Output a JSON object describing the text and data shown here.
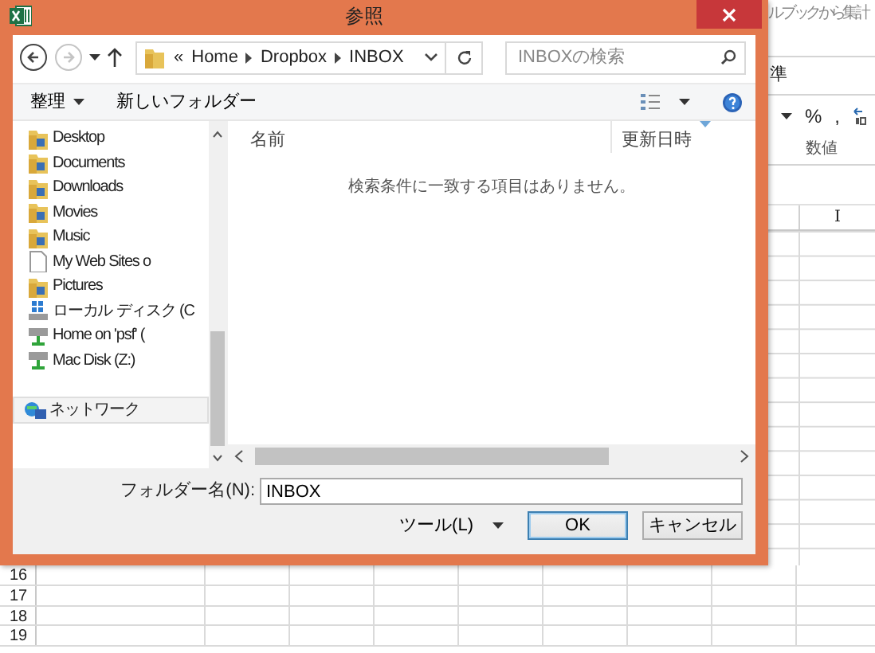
{
  "dialog": {
    "title": "参照",
    "navigation": {
      "back_disabled": false,
      "forward_disabled": true
    },
    "address": {
      "overflow": "«",
      "crumbs": [
        "Home",
        "Dropbox",
        "INBOX"
      ]
    },
    "search": {
      "placeholder": "INBOXの検索"
    },
    "toolbar": {
      "organize": "整理",
      "new_folder": "新しいフォルダー"
    },
    "nav_items": [
      {
        "label": "Desktop",
        "kind": "folder",
        "selected": false
      },
      {
        "label": "Documents",
        "kind": "folder",
        "selected": false
      },
      {
        "label": "Downloads",
        "kind": "folder",
        "selected": false
      },
      {
        "label": "Movies",
        "kind": "folder",
        "selected": false
      },
      {
        "label": "Music",
        "kind": "folder",
        "selected": false
      },
      {
        "label": "My Web Sites o",
        "kind": "file",
        "selected": false
      },
      {
        "label": "Pictures",
        "kind": "folder",
        "selected": false
      },
      {
        "label": "ローカル ディスク (C",
        "kind": "drive",
        "selected": false
      },
      {
        "label": "Home on 'psf' (",
        "kind": "netdrive",
        "selected": false
      },
      {
        "label": "Mac Disk (Z:)",
        "kind": "netdrive",
        "selected": false
      },
      {
        "label": "ネットワーク",
        "kind": "network",
        "selected": true
      }
    ],
    "columns": [
      {
        "label": "名前",
        "sorted": false
      },
      {
        "label": "更新日時",
        "sorted": true
      }
    ],
    "empty_message": "検索条件に一致する項目はありません。",
    "folder_name": {
      "label": "フォルダー名(N):",
      "value": "INBOX"
    },
    "tools": "ツール(L)",
    "buttons": [
      {
        "label": "OK",
        "default": true
      },
      {
        "label": "キャンセル",
        "default": false
      }
    ]
  },
  "spreadsheet": {
    "ribbon_title": "ル ブックから集計",
    "format_box": "準",
    "number_buttons": [
      "%",
      ","
    ],
    "group_label": "数値",
    "column_header": "I",
    "row_numbers": [
      "16",
      "17",
      "18",
      "19"
    ]
  }
}
